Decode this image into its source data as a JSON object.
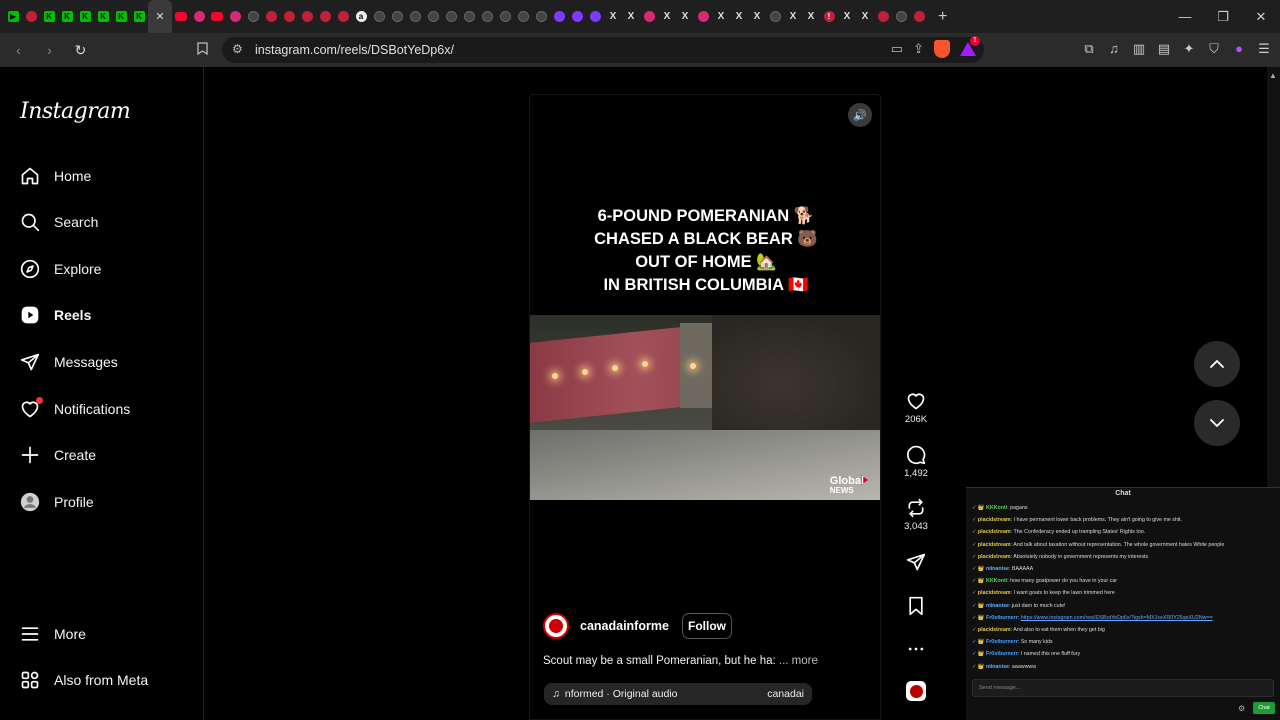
{
  "browser": {
    "tabs_before": [
      {
        "icon": "play-icon",
        "cls": "green",
        "g": "▶"
      },
      {
        "icon": "instagram-icon",
        "cls": "red",
        "g": ""
      },
      {
        "icon": "kick-icon",
        "cls": "green",
        "g": "K"
      },
      {
        "icon": "kick-icon",
        "cls": "green",
        "g": "K"
      },
      {
        "icon": "kick-icon",
        "cls": "green",
        "g": "K"
      },
      {
        "icon": "kick-icon",
        "cls": "green",
        "g": "K"
      },
      {
        "icon": "kick-icon",
        "cls": "green",
        "g": "K"
      },
      {
        "icon": "kick-icon",
        "cls": "green",
        "g": "K"
      }
    ],
    "active_tab_close": "✕",
    "tabs_after": [
      {
        "icon": "youtube-icon",
        "cls": "yt",
        "g": ""
      },
      {
        "icon": "instagram-icon",
        "cls": "pink",
        "g": ""
      },
      {
        "icon": "youtube-icon",
        "cls": "yt",
        "g": ""
      },
      {
        "icon": "instagram-icon",
        "cls": "pink",
        "g": ""
      },
      {
        "icon": "tab-icon",
        "cls": "gray",
        "g": ""
      },
      {
        "icon": "tab-icon",
        "cls": "red",
        "g": ""
      },
      {
        "icon": "tab-icon",
        "cls": "red",
        "g": ""
      },
      {
        "icon": "tab-icon",
        "cls": "red",
        "g": ""
      },
      {
        "icon": "tab-icon",
        "cls": "red",
        "g": ""
      },
      {
        "icon": "tab-icon",
        "cls": "red",
        "g": ""
      },
      {
        "icon": "amazon-icon",
        "cls": "white",
        "g": "a"
      },
      {
        "icon": "tab-icon",
        "cls": "gray",
        "g": ""
      },
      {
        "icon": "tab-icon",
        "cls": "gray",
        "g": ""
      },
      {
        "icon": "tab-icon",
        "cls": "gray",
        "g": ""
      },
      {
        "icon": "tab-icon",
        "cls": "gray",
        "g": ""
      },
      {
        "icon": "tab-icon",
        "cls": "gray",
        "g": ""
      },
      {
        "icon": "tab-icon",
        "cls": "gray",
        "g": ""
      },
      {
        "icon": "tab-icon",
        "cls": "gray",
        "g": ""
      },
      {
        "icon": "tab-icon",
        "cls": "gray",
        "g": ""
      },
      {
        "icon": "tab-icon",
        "cls": "gray",
        "g": ""
      },
      {
        "icon": "tab-icon",
        "cls": "gray",
        "g": ""
      },
      {
        "icon": "twitch-icon",
        "cls": "purple",
        "g": ""
      },
      {
        "icon": "twitch-icon",
        "cls": "purple",
        "g": ""
      },
      {
        "icon": "twitch-icon",
        "cls": "purple",
        "g": ""
      },
      {
        "icon": "x-icon",
        "cls": "x",
        "g": "X"
      },
      {
        "icon": "x-icon",
        "cls": "x",
        "g": "X"
      },
      {
        "icon": "instagram-icon",
        "cls": "pink",
        "g": ""
      },
      {
        "icon": "x-icon",
        "cls": "x",
        "g": "X"
      },
      {
        "icon": "x-icon",
        "cls": "x",
        "g": "X"
      },
      {
        "icon": "instagram-icon",
        "cls": "pink",
        "g": ""
      },
      {
        "icon": "x-icon",
        "cls": "x",
        "g": "X"
      },
      {
        "icon": "x-icon",
        "cls": "x",
        "g": "X"
      },
      {
        "icon": "x-icon",
        "cls": "x",
        "g": "X"
      },
      {
        "icon": "tab-icon",
        "cls": "gray",
        "g": ""
      },
      {
        "icon": "x-icon",
        "cls": "x",
        "g": "X"
      },
      {
        "icon": "x-icon",
        "cls": "x",
        "g": "X"
      },
      {
        "icon": "tab-icon",
        "cls": "red",
        "g": "!"
      },
      {
        "icon": "x-icon",
        "cls": "x",
        "g": "X"
      },
      {
        "icon": "x-icon",
        "cls": "x",
        "g": "X"
      },
      {
        "icon": "tab-icon",
        "cls": "red",
        "g": ""
      },
      {
        "icon": "tab-icon",
        "cls": "gray",
        "g": ""
      },
      {
        "icon": "tab-icon",
        "cls": "red",
        "g": ""
      }
    ],
    "new_tab": "+",
    "window_controls": {
      "minimize": "—",
      "restore": "❐",
      "close": "✕"
    },
    "url": "instagram.com/reels/DSBotYeDp6x/",
    "extension_badge": "1"
  },
  "sidebar": {
    "logo": "Instagram",
    "items": [
      {
        "key": "home",
        "label": "Home",
        "icon": "home-icon",
        "bold": false
      },
      {
        "key": "search",
        "label": "Search",
        "icon": "search-icon",
        "bold": false
      },
      {
        "key": "explore",
        "label": "Explore",
        "icon": "compass-icon",
        "bold": false
      },
      {
        "key": "reels",
        "label": "Reels",
        "icon": "reels-icon",
        "bold": true
      },
      {
        "key": "messages",
        "label": "Messages",
        "icon": "send-icon",
        "bold": false
      },
      {
        "key": "notifications",
        "label": "Notifications",
        "icon": "heart-icon",
        "bold": false
      },
      {
        "key": "create",
        "label": "Create",
        "icon": "plus-icon",
        "bold": false
      },
      {
        "key": "profile",
        "label": "Profile",
        "icon": "profile-icon",
        "bold": false
      }
    ],
    "more": "More",
    "also_from_meta": "Also from Meta"
  },
  "reel": {
    "headline": [
      "6-POUND POMERANIAN 🐕",
      "CHASED A BLACK BEAR 🐻",
      "OUT OF HOME 🏡",
      "IN BRITISH COLUMBIA 🇨🇦"
    ],
    "watermark": "Global",
    "watermark_sub": "NEWS",
    "author": "canadainforme",
    "follow": "Follow",
    "caption": "Scout may be a small Pomeranian, but he ha: ",
    "caption_more": "... more",
    "audio": "nformed · Original audio",
    "audio_source": "canadai",
    "likes": "206K",
    "comments": "1,492",
    "reposts": "3,043"
  },
  "chat": {
    "title": "Chat",
    "messages": [
      {
        "user": "KKKonti",
        "color": "#5fd35f",
        "badge": "👑",
        "text": "pagans"
      },
      {
        "user": "placidstream",
        "color": "#e2c84b",
        "badge": "",
        "text": "I have permanent lower back problems. They ain't going to give me shit."
      },
      {
        "user": "placidstream",
        "color": "#e2c84b",
        "badge": "",
        "text": "The Confederacy ended up trampling States' Rights too."
      },
      {
        "user": "placidstream",
        "color": "#e2c84b",
        "badge": "",
        "text": "And talk about taxation without representation. The whole government hates White people"
      },
      {
        "user": "placidstream",
        "color": "#e2c84b",
        "badge": "",
        "text": "Absolutely nobody in government represents my interests"
      },
      {
        "user": "niinanise",
        "color": "#63b3ff",
        "badge": "👑",
        "text": "BAAAAA"
      },
      {
        "user": "KKKonti",
        "color": "#5fd35f",
        "badge": "👑",
        "text": "how many goatpower do you have in your car"
      },
      {
        "user": "placidstream",
        "color": "#e2c84b",
        "badge": "",
        "text": "I want goats to keep the lawn trimmed here"
      },
      {
        "user": "niinanise",
        "color": "#63b3ff",
        "badge": "👑",
        "text": "just darn to much cute!"
      },
      {
        "user": "Fr0stburnerr",
        "color": "#4aa3ff",
        "badge": "👑",
        "text": "",
        "link": "https://www.instagram.com/reel/DSBotYeDp6x/?igsh=MXJxeXR0Y25qeXU2Nw=="
      },
      {
        "user": "placidstream",
        "color": "#e2c84b",
        "badge": "",
        "text": "And also to eat them when they get big"
      },
      {
        "user": "Fr0stburnerr",
        "color": "#4aa3ff",
        "badge": "👑",
        "text": "So many kids"
      },
      {
        "user": "Fr0stburnerr",
        "color": "#4aa3ff",
        "badge": "👑",
        "text": "I named this one fluff fury"
      },
      {
        "user": "niinanise",
        "color": "#63b3ff",
        "badge": "👑",
        "text": "aaawwww"
      }
    ],
    "input_placeholder": "Send message...",
    "send": "Chat"
  }
}
